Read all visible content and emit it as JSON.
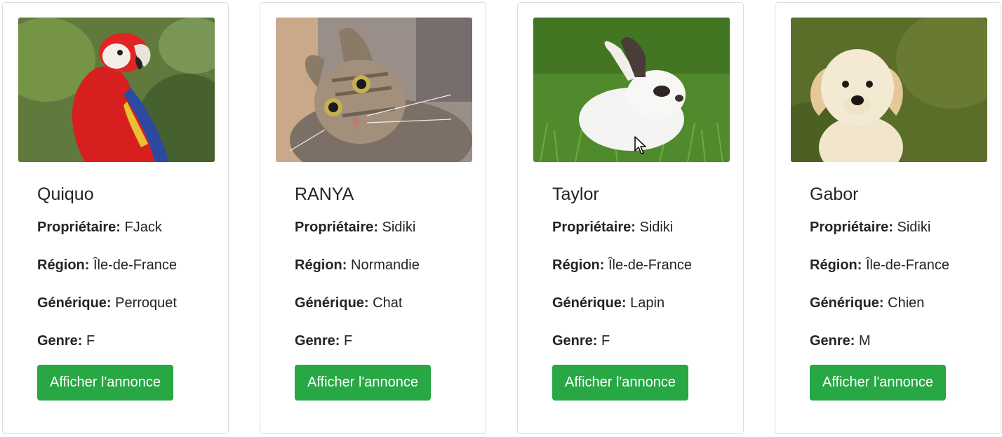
{
  "labels": {
    "owner": "Propriétaire:",
    "region": "Région:",
    "generic": "Générique:",
    "gender": "Genre:"
  },
  "button_label": "Afficher l'annonce",
  "accent_color": "#28a745",
  "cards": [
    {
      "name": "Quiquo",
      "owner": "FJack",
      "region": "Île-de-France",
      "generic": "Perroquet",
      "gender": "F",
      "photo": "parrot"
    },
    {
      "name": "RANYA",
      "owner": "Sidiki",
      "region": "Normandie",
      "generic": "Chat",
      "gender": "F",
      "photo": "cat"
    },
    {
      "name": "Taylor",
      "owner": "Sidiki",
      "region": "Île-de-France",
      "generic": "Lapin",
      "gender": "F",
      "photo": "rabbit"
    },
    {
      "name": "Gabor",
      "owner": "Sidiki",
      "region": "Île-de-France",
      "generic": "Chien",
      "gender": "M",
      "photo": "dog"
    }
  ]
}
